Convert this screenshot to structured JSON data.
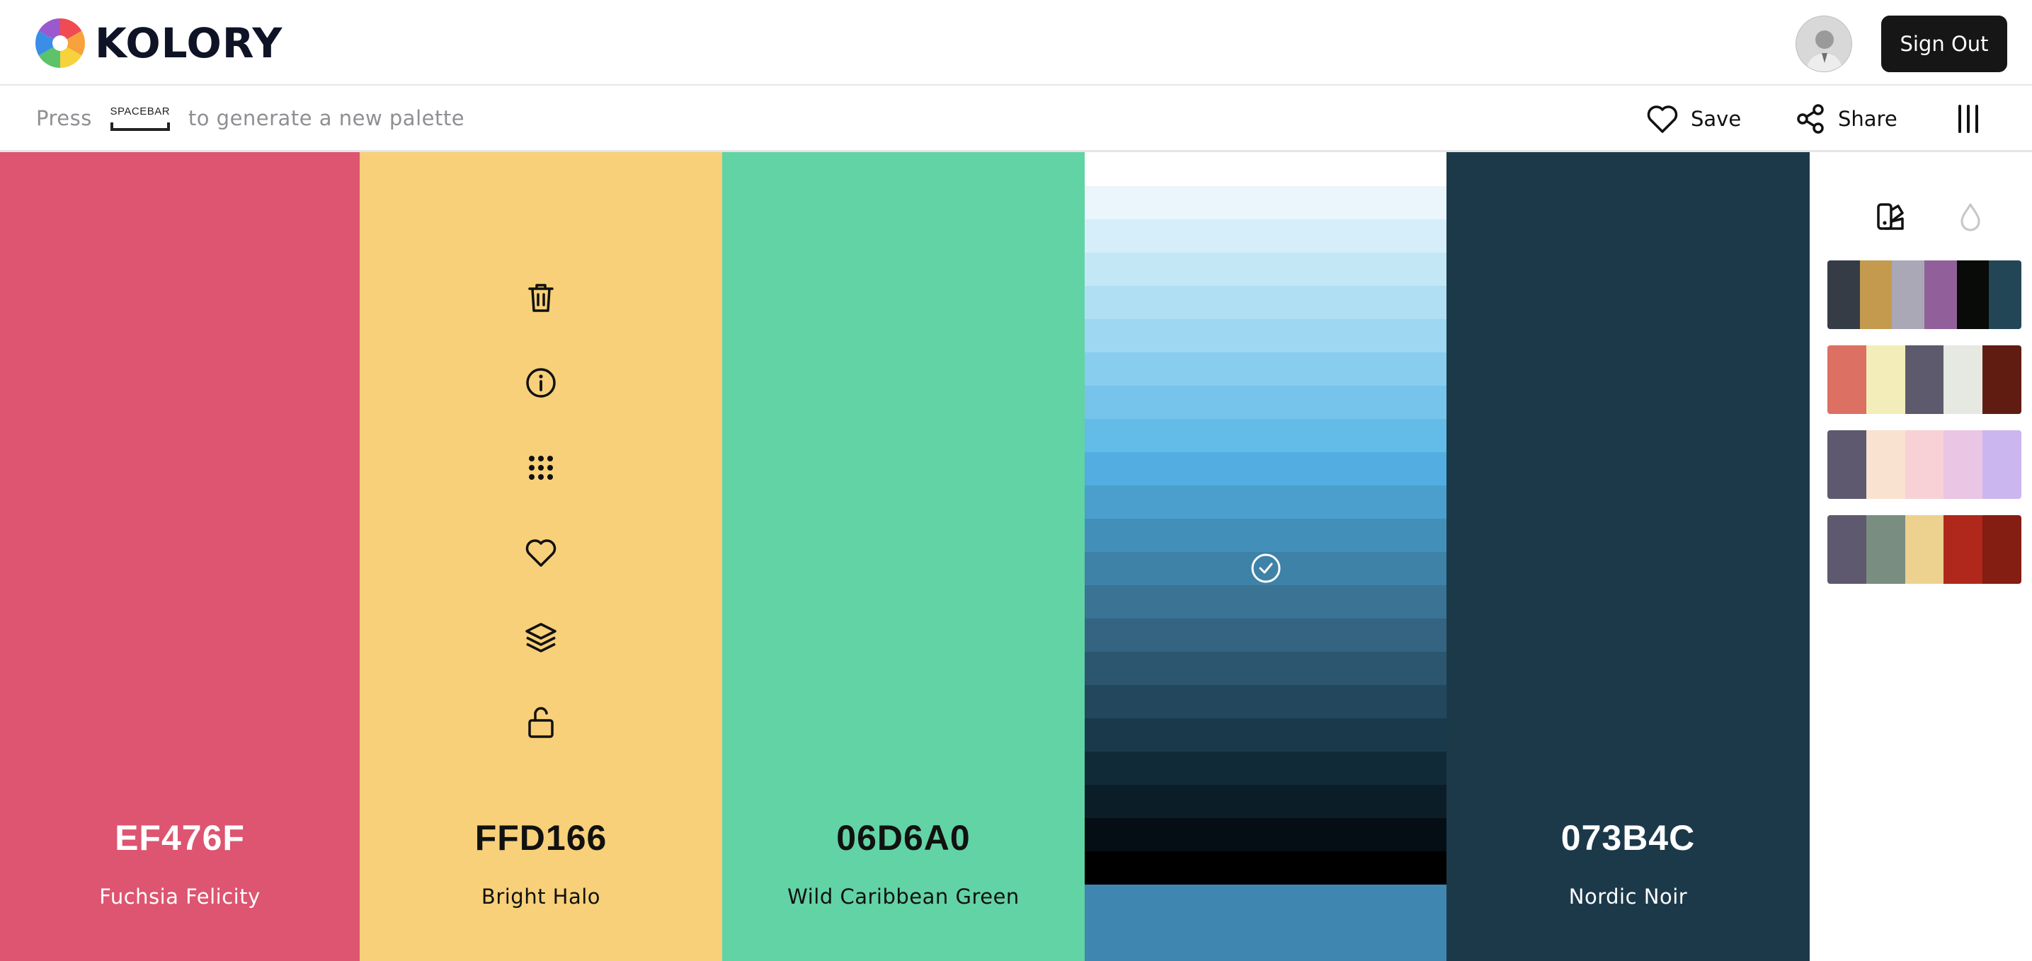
{
  "app": {
    "brand": "KOLORY",
    "sign_out_label": "Sign Out"
  },
  "toolbar": {
    "hint_press": "Press",
    "hint_key": "SPACEBAR",
    "hint_rest": "to generate a new palette",
    "save_label": "Save",
    "share_label": "Share",
    "icons": [
      "heart-icon",
      "share-icon",
      "columns-menu-icon"
    ]
  },
  "palette": [
    {
      "hex": "EF476F",
      "name": "Fuchsia Felicity",
      "color": "#dd5570",
      "text_color": "#ffffff"
    },
    {
      "hex": "FFD166",
      "name": "Bright Halo",
      "color": "#f7d079",
      "text_color": "#111111"
    },
    {
      "hex": "06D6A0",
      "name": "Wild Caribbean Green",
      "color": "#62d3a4",
      "text_color": "#111111"
    },
    {
      "hex": "",
      "name": "",
      "color": "#3f87b0",
      "text_color": "#ffffff"
    },
    {
      "hex": "073B4C",
      "name": "Nordic Noir",
      "color": "#1c394a",
      "text_color": "#ffffff"
    }
  ],
  "column_actions": [
    "trash-icon",
    "info-icon",
    "grid-dots-icon",
    "heart-icon",
    "layers-icon",
    "unlock-icon"
  ],
  "shades": [
    "#eaf5fc",
    "#d6eefa",
    "#c4e7f6",
    "#b0dff4",
    "#9dd7f1",
    "#89cdee",
    "#76c4eb",
    "#63bbe7",
    "#53ade0",
    "#4a9fcd",
    "#4290ba",
    "#3e82a7",
    "#3a7394",
    "#356482",
    "#2c566f",
    "#23485d",
    "#1a3a4b",
    "#112a38",
    "#0b1d27",
    "#050e14",
    "#000000"
  ],
  "selected_shade_index": 11,
  "panel": {
    "tabs": [
      "palette-tab-icon",
      "drop-tab-icon"
    ],
    "palettes": [
      [
        "#353c46",
        "#c49a4e",
        "#aaa8b6",
        "#915f9a",
        "#090b08",
        "#234657"
      ],
      [
        "#dc7062",
        "#f3eeb9",
        "#5e5a6e",
        "#e6e9e1",
        "#611c12"
      ],
      [
        "#5e596e",
        "#f9e2cf",
        "#f7d1d5",
        "#eac5e4",
        "#cbb6ef"
      ],
      [
        "#5e596e",
        "#7a8d81",
        "#edd18f",
        "#b0271b",
        "#841d12"
      ]
    ]
  }
}
